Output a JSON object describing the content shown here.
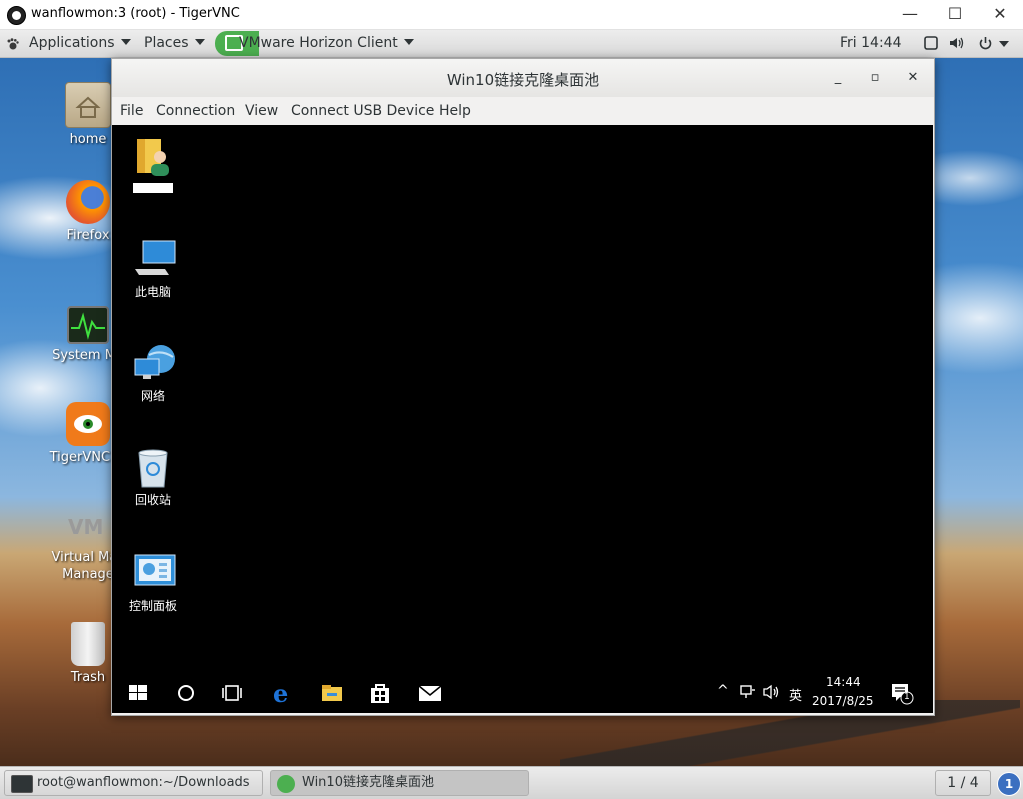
{
  "vnc_window": {
    "title": "wanflowmon:3 (root) - TigerVNC",
    "minimize_glyph": "—",
    "maximize_glyph": "☐",
    "close_glyph": "✕"
  },
  "top_panel": {
    "applications_label": "Applications",
    "places_label": "Places",
    "active_app_label": "VMware Horizon Client",
    "clock": "Fri 14:44",
    "tray_icons": [
      "screen-icon",
      "volume-icon",
      "power-icon"
    ]
  },
  "desktop_icons": [
    {
      "label": "home",
      "icon": "home-folder-icon"
    },
    {
      "label": "Firefox",
      "icon": "firefox-icon"
    },
    {
      "label": "System Mo",
      "icon": "system-monitor-icon"
    },
    {
      "label": "TigerVNC Vi",
      "icon": "tigervnc-icon"
    },
    {
      "label": "Virtual Mac",
      "label2": "Manage",
      "icon": "vmm-icon"
    },
    {
      "label": "Trash",
      "icon": "trash-icon"
    }
  ],
  "horizon_window": {
    "title": "Win10链接克隆桌面池",
    "minimize_glyph": "_",
    "maximize_glyph": "▫",
    "close_glyph": "✕",
    "menu": [
      "File",
      "Connection",
      "View",
      "Connect USB Device",
      "Help"
    ]
  },
  "remote_desktop": {
    "icons": [
      {
        "label": "",
        "icon": "user-folder-icon"
      },
      {
        "label": "此电脑",
        "icon": "this-pc-icon"
      },
      {
        "label": "网络",
        "icon": "network-icon"
      },
      {
        "label": "回收站",
        "icon": "recycle-bin-icon"
      },
      {
        "label": "控制面板",
        "icon": "control-panel-icon"
      }
    ],
    "taskbar": {
      "ime": "英",
      "time": "14:44",
      "date": "2017/8/25",
      "notification_count": "1"
    }
  },
  "bottom_panel": {
    "tasks": [
      {
        "label": "root@wanflowmon:~/Downloads",
        "icon": "terminal-icon"
      },
      {
        "label": "Win10链接克隆桌面池",
        "icon": "horizon-icon"
      }
    ],
    "workspace": "1 / 4",
    "notification_badge": "1"
  },
  "colors": {
    "horizon_green": "#4caf50",
    "badge_blue": "#3b6fc0",
    "edge_blue": "#1e73d8"
  }
}
